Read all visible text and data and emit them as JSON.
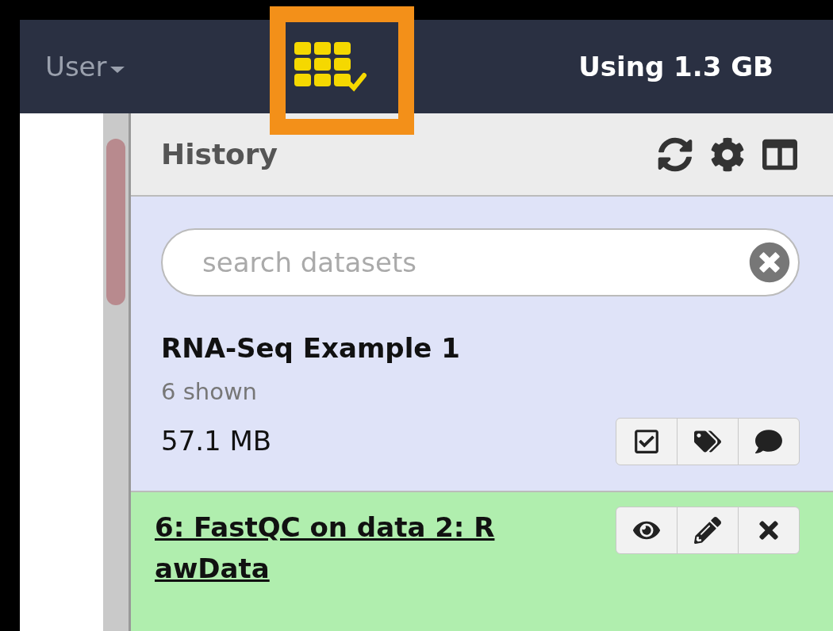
{
  "navbar": {
    "user_menu": "User",
    "quota": "Using 1.3 GB",
    "apps_highlighted": true
  },
  "history": {
    "title": "History",
    "search": {
      "placeholder": "search datasets"
    },
    "name": "RNA-Seq Example 1",
    "shown": "6 shown",
    "size": "57.1 MB",
    "datasets": [
      {
        "title": "6: FastQC on data 2: RawData",
        "color": "#b0eeae"
      }
    ]
  }
}
